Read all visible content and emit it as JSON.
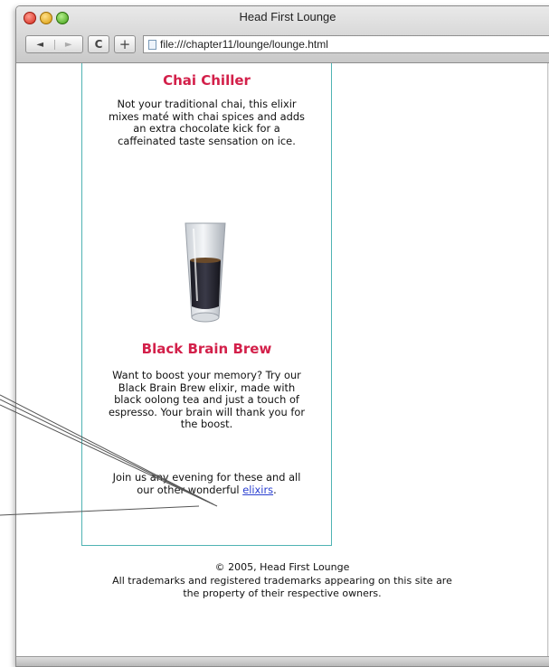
{
  "window": {
    "title": "Head First Lounge"
  },
  "toolbar": {
    "back_symbol": "◄",
    "forward_symbol": "►",
    "reload_symbol": "C",
    "add_symbol": "+",
    "url": "file:///chapter11/lounge/lounge.html"
  },
  "sidebar": {
    "elixirs": [
      {
        "name": "Chai Chiller",
        "description": "Not your traditional chai, this elixir mixes maté with chai spices and adds an extra chocolate kick for a caffeinated taste sensation on ice."
      },
      {
        "name": "Black Brain Brew",
        "description": "Want to boost your memory? Try our Black Brain Brew elixir, made with black oolong tea and just a touch of espresso. Your brain will thank you for the boost."
      }
    ],
    "join_text": "Join us any evening for these and all our other wonderful",
    "join_link": "elixirs",
    "join_period": "."
  },
  "footer": {
    "copyright": "© 2005, Head First Lounge",
    "trademark_line1": "All trademarks and registered trademarks appearing on this site are",
    "trademark_line2": "the property of their respective owners."
  },
  "colors": {
    "elixir_heading": "#d3204a",
    "sidebar_border": "#4fb3b3",
    "link": "#2a3fd0",
    "scroll_thumb": "#2a63c0"
  }
}
